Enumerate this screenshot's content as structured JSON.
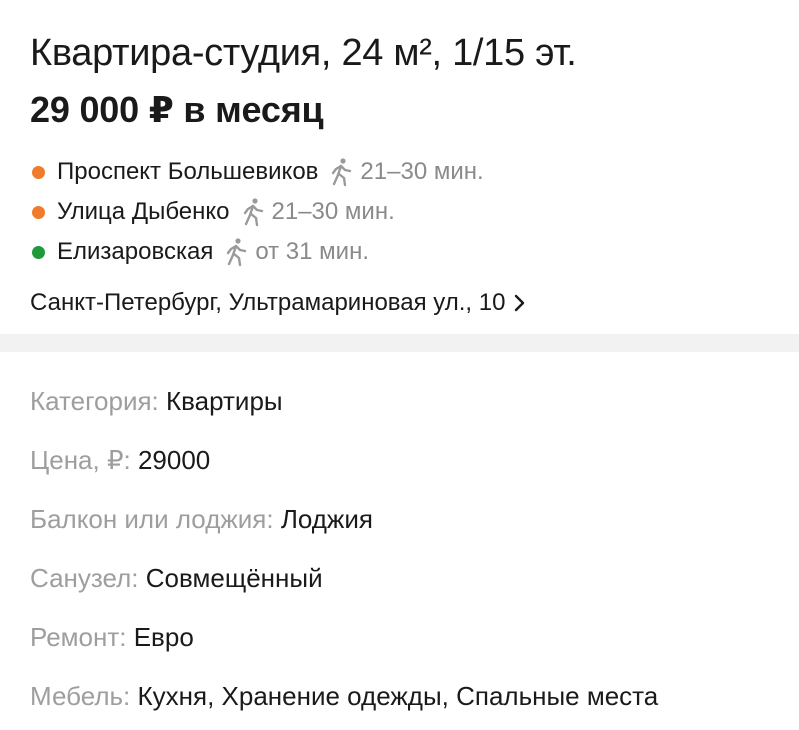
{
  "listing": {
    "title": "Квартира-студия, 24 м², 1/15 эт.",
    "price": "29 000 ₽ в месяц",
    "metro": [
      {
        "name": "Проспект Большевиков",
        "time": "21–30 мин.",
        "color": "#f07b2a",
        "icon": "walk-icon"
      },
      {
        "name": "Улица Дыбенко",
        "time": "21–30 мин.",
        "color": "#f07b2a",
        "icon": "walk-icon"
      },
      {
        "name": "Елизаровская",
        "time": "от 31 мин.",
        "color": "#1f9a3a",
        "icon": "walk-icon"
      }
    ],
    "address": "Санкт-Петербург, Ультрамариновая ул., 10",
    "address_icon": "chevron-right-icon"
  },
  "params": [
    {
      "label": "Категория:",
      "value": "Квартиры"
    },
    {
      "label": "Цена, ₽:",
      "value": "29000"
    },
    {
      "label": "Балкон или лоджия:",
      "value": "Лоджия"
    },
    {
      "label": "Санузел:",
      "value": "Совмещённый"
    },
    {
      "label": "Ремонт:",
      "value": "Евро"
    },
    {
      "label": "Мебель:",
      "value": "Кухня, Хранение одежды, Спальные места"
    }
  ],
  "colors": {
    "text": "#1a1a1a",
    "muted": "#8a8a8a",
    "label": "#9e9e9e",
    "divider": "#f2f2f2"
  }
}
